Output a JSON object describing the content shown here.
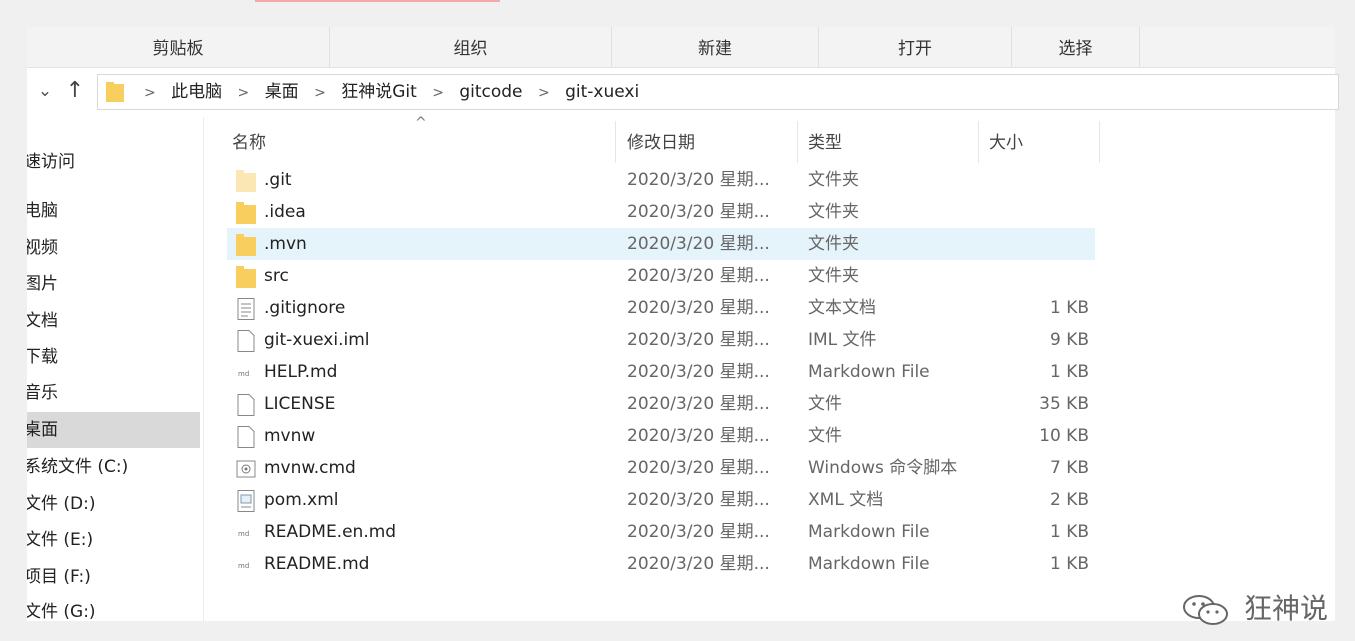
{
  "ribbon": {
    "groups": [
      "剪贴板",
      "组织",
      "新建",
      "打开",
      "选择"
    ]
  },
  "nav": {
    "down_icon": "chevron-down-icon",
    "up_icon": "arrow-up-icon",
    "down_glyph": "⌄",
    "up_glyph": "↑",
    "breadcrumbs": [
      "此电脑",
      "桌面",
      "狂神说Git",
      "gitcode",
      "git-xuexi"
    ]
  },
  "sidebar": {
    "items": [
      {
        "label": "速访问",
        "selected": false
      },
      {
        "label": "电脑",
        "selected": false
      },
      {
        "label": "视频",
        "selected": false
      },
      {
        "label": "图片",
        "selected": false
      },
      {
        "label": "文档",
        "selected": false
      },
      {
        "label": "下载",
        "selected": false
      },
      {
        "label": "音乐",
        "selected": false
      },
      {
        "label": "桌面",
        "selected": true
      },
      {
        "label": "系统文件 (C:)",
        "selected": false
      },
      {
        "label": "文件 (D:)",
        "selected": false
      },
      {
        "label": "文件 (E:)",
        "selected": false
      },
      {
        "label": "项目 (F:)",
        "selected": false
      },
      {
        "label": "文件 (G:)",
        "selected": false
      }
    ]
  },
  "columns": {
    "name": "名称",
    "modified": "修改日期",
    "type": "类型",
    "size": "大小",
    "sort_glyph": "^"
  },
  "files": [
    {
      "name": ".git",
      "date": "2020/3/20 星期...",
      "type": "文件夹",
      "size": "",
      "icon": "folder-faded"
    },
    {
      "name": ".idea",
      "date": "2020/3/20 星期...",
      "type": "文件夹",
      "size": "",
      "icon": "folder"
    },
    {
      "name": ".mvn",
      "date": "2020/3/20 星期...",
      "type": "文件夹",
      "size": "",
      "icon": "folder"
    },
    {
      "name": "src",
      "date": "2020/3/20 星期...",
      "type": "文件夹",
      "size": "",
      "icon": "folder"
    },
    {
      "name": ".gitignore",
      "date": "2020/3/20 星期...",
      "type": "文本文档",
      "size": "1 KB",
      "icon": "text"
    },
    {
      "name": "git-xuexi.iml",
      "date": "2020/3/20 星期...",
      "type": "IML 文件",
      "size": "9 KB",
      "icon": "file"
    },
    {
      "name": "HELP.md",
      "date": "2020/3/20 星期...",
      "type": "Markdown File",
      "size": "1 KB",
      "icon": "md"
    },
    {
      "name": "LICENSE",
      "date": "2020/3/20 星期...",
      "type": "文件",
      "size": "35 KB",
      "icon": "file"
    },
    {
      "name": "mvnw",
      "date": "2020/3/20 星期...",
      "type": "文件",
      "size": "10 KB",
      "icon": "file"
    },
    {
      "name": "mvnw.cmd",
      "date": "2020/3/20 星期...",
      "type": "Windows 命令脚本",
      "size": "7 KB",
      "icon": "cmd"
    },
    {
      "name": "pom.xml",
      "date": "2020/3/20 星期...",
      "type": "XML 文档",
      "size": "2 KB",
      "icon": "xml"
    },
    {
      "name": "README.en.md",
      "date": "2020/3/20 星期...",
      "type": "Markdown File",
      "size": "1 KB",
      "icon": "md"
    },
    {
      "name": "README.md",
      "date": "2020/3/20 星期...",
      "type": "Markdown File",
      "size": "1 KB",
      "icon": "md"
    }
  ],
  "hover_row": 2,
  "watermark": {
    "text": "狂神说",
    "icon": "wechat-icon"
  },
  "colors": {
    "folder": "#f8cf5f",
    "folder_faded": "#fbe7b4",
    "hover": "#e5f3fb",
    "selected": "#d9d9d9"
  }
}
